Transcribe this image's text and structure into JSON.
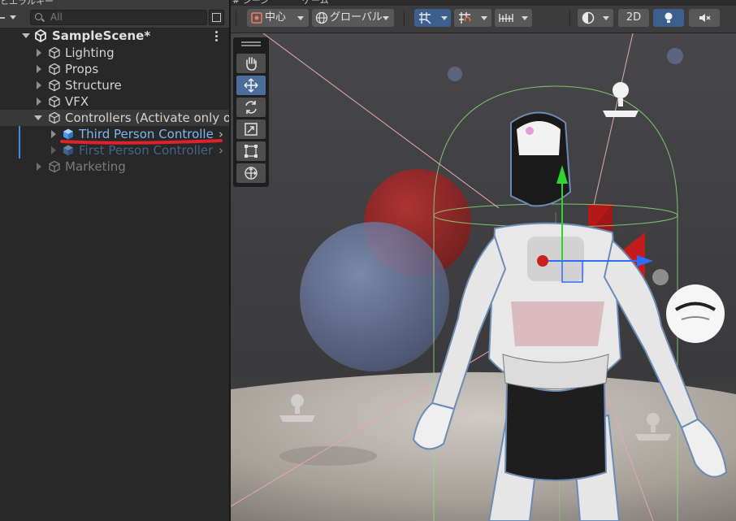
{
  "hierarchy": {
    "tab_label_fragment": "ヒエラルキー",
    "search": {
      "placeholder": "All"
    },
    "scene_name": "SampleScene*",
    "items": [
      {
        "label": "Lighting",
        "expanded": false,
        "dimmed": false
      },
      {
        "label": "Props",
        "expanded": false,
        "dimmed": false
      },
      {
        "label": "Structure",
        "expanded": false,
        "dimmed": false
      },
      {
        "label": "VFX",
        "expanded": false,
        "dimmed": false
      },
      {
        "label": "Controllers (Activate only one)",
        "expanded": true,
        "dimmed": false,
        "children": [
          {
            "label": "Third Person Controller",
            "prefab": true,
            "selected": true
          },
          {
            "label": "First Person Controller",
            "prefab": true,
            "dimmed": true
          }
        ]
      },
      {
        "label": "Marketing",
        "expanded": false,
        "dimmed": true
      }
    ]
  },
  "scene_view": {
    "tab_label_fragments": [
      "# シーン",
      "ゲーム"
    ],
    "toolbar": {
      "pivot_label": "中心",
      "space_label": "グローバル",
      "mode_2d_label": "2D",
      "icons": [
        "move-gizmo-icon",
        "pivot-icon",
        "globe-icon",
        "grid-snap-icon",
        "snap-increment-icon",
        "ruler-icon",
        "shading-mode-icon",
        "light-icon",
        "audio-mute-icon"
      ]
    },
    "tools": [
      "hand-tool-icon",
      "move-tool-icon",
      "rotate-tool-icon",
      "scale-tool-icon",
      "rect-tool-icon",
      "transform-tool-icon"
    ],
    "active_tool": "move-tool-icon",
    "colors": {
      "selection_blue": "#3d8fe0",
      "prefab_blue": "#7fb5f0",
      "annotation_red": "#e0212a",
      "x_axis": "#2f6bff",
      "y_axis": "#2dd42d",
      "capsule_wire": "#8fe07f"
    }
  }
}
